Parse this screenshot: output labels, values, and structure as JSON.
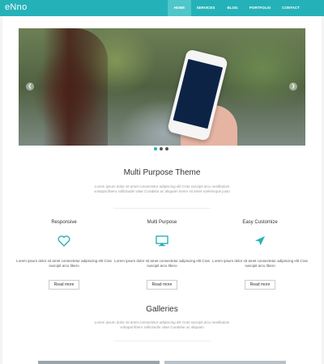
{
  "nav": {
    "logo": "eNno",
    "items": [
      "HOME",
      "SERVICES",
      "BLOG",
      "PORTFOLIO",
      "CONTACT"
    ]
  },
  "hero": {
    "prev_icon": "chevron-left-icon",
    "next_icon": "chevron-right-icon",
    "dots_count": 3,
    "active_dot": 1
  },
  "intro": {
    "title": "Multi Purpose Theme",
    "text": "Lorem ipsum dolor sit amet consectetur adipiscing elit Cras suscipit arcu vestibulum volutpat libero sollicitudin vitae Curabitur ac aliquam lorem sit amet scelerisque justo"
  },
  "features": [
    {
      "title": "Responsive",
      "icon": "heart-icon",
      "text": "Lorem ipsum dolor sit amet consectetur adipiscing elit Cras suscipit arcu libero",
      "button": "Read more"
    },
    {
      "title": "Multi Purpose",
      "icon": "monitor-icon",
      "text": "Lorem ipsum dolor sit amet consectetur adipiscing elit Cras suscipit arcu libero",
      "button": "Read more"
    },
    {
      "title": "Easy Customize",
      "icon": "paper-plane-icon",
      "text": "Lorem ipsum dolor sit amet consectetur adipiscing elit Cras suscipit arcu libero",
      "button": "Read more"
    }
  ],
  "galleries": {
    "title": "Galleries",
    "text": "Lorem ipsum dolor sit amet consectetur adipiscing elit Cras suscipit arcu vestibulum volutpat libero sollicitudin vitae Curabitur ac aliquam"
  },
  "colors": {
    "accent": "#24b2b8",
    "accent_light": "#4fc6ca"
  }
}
